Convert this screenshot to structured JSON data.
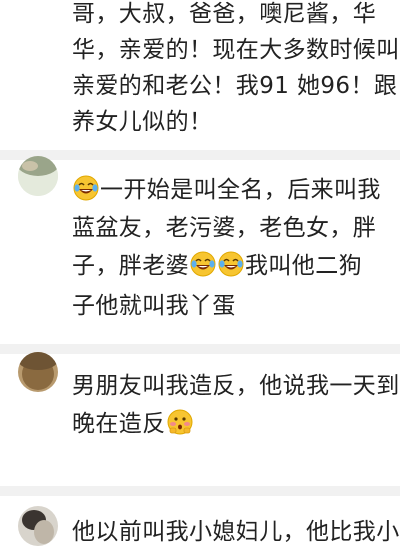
{
  "comments": [
    {
      "lines": [
        "哥，大叔，爸爸，噢尼酱，华",
        "华，亲爱的！现在大多数时候叫",
        "亲爱的和老公！我91  她96！跟",
        "养女儿似的！"
      ]
    },
    {
      "line1": "一开始是叫全名，后来叫我",
      "line2": "蓝盆友，老污婆，老色女，胖",
      "line3_before": "子，胖老婆",
      "line3_after": "我叫他二狗",
      "line4": "子他就叫我丫蛋",
      "emoji_name": "laughing-crying-emoji"
    },
    {
      "line1": "男朋友叫我造反，他说我一天到",
      "line2": "晚在造反",
      "emoji_name": "blushing-emoji"
    },
    {
      "line1": "他以前叫我小媳妇儿，他比我小"
    }
  ]
}
